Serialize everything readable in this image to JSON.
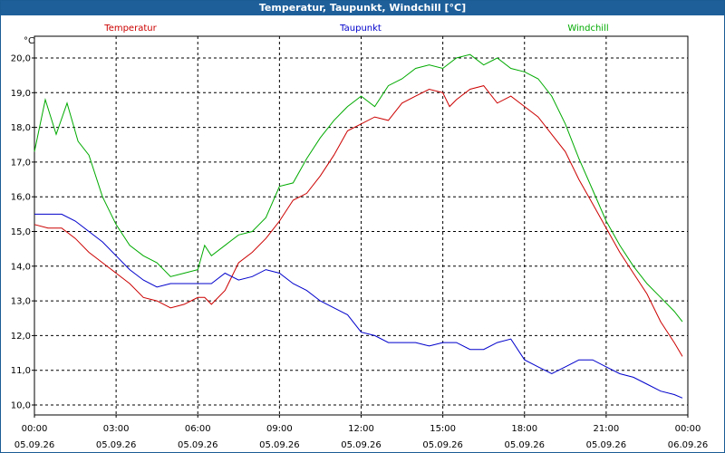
{
  "window": {
    "title": "Temperatur, Taupunkt, Windchill [°C]"
  },
  "chart_data": {
    "type": "line",
    "title": "Temperatur, Taupunkt, Windchill [°C]",
    "ylabel": "°C",
    "xlabel": "",
    "ylim": [
      9.8,
      20.6
    ],
    "xlim": [
      0,
      24
    ],
    "grid": true,
    "legend_placement": "top",
    "y_ticks": [
      "10,0",
      "11,0",
      "12,0",
      "13,0",
      "14,0",
      "15,0",
      "16,0",
      "17,0",
      "18,0",
      "19,0",
      "20,0"
    ],
    "x_ticks": [
      {
        "time": "00:00",
        "date": "05.09.26"
      },
      {
        "time": "03:00",
        "date": "05.09.26"
      },
      {
        "time": "06:00",
        "date": "05.09.26"
      },
      {
        "time": "09:00",
        "date": "05.09.26"
      },
      {
        "time": "12:00",
        "date": "05.09.26"
      },
      {
        "time": "15:00",
        "date": "05.09.26"
      },
      {
        "time": "18:00",
        "date": "05.09.26"
      },
      {
        "time": "21:00",
        "date": "05.09.26"
      },
      {
        "time": "00:00",
        "date": "06.09.26"
      }
    ],
    "series": [
      {
        "name": "Temperatur",
        "color": "#cc0000",
        "x": [
          0,
          0.5,
          1,
          1.5,
          2,
          2.5,
          3,
          3.5,
          4,
          4.5,
          5,
          5.5,
          6,
          6.25,
          6.5,
          7,
          7.5,
          8,
          8.5,
          9,
          9.5,
          10,
          10.5,
          11,
          11.5,
          12,
          12.5,
          13,
          13.5,
          14,
          14.5,
          15,
          15.25,
          15.5,
          16,
          16.5,
          17,
          17.5,
          18,
          18.5,
          19,
          19.5,
          20,
          20.5,
          21,
          21.5,
          22,
          22.5,
          23,
          23.5,
          23.8
        ],
        "y": [
          15.2,
          15.1,
          15.1,
          14.8,
          14.4,
          14.1,
          13.8,
          13.5,
          13.1,
          13.0,
          12.8,
          12.9,
          13.1,
          13.1,
          12.9,
          13.3,
          14.1,
          14.4,
          14.8,
          15.3,
          15.9,
          16.1,
          16.6,
          17.2,
          17.9,
          18.1,
          18.3,
          18.2,
          18.7,
          18.9,
          19.1,
          19.0,
          18.6,
          18.8,
          19.1,
          19.2,
          18.7,
          18.9,
          18.6,
          18.3,
          17.8,
          17.3,
          16.5,
          15.8,
          15.1,
          14.4,
          13.8,
          13.2,
          12.4,
          11.8,
          11.4
        ]
      },
      {
        "name": "Taupunkt",
        "color": "#0000cc",
        "x": [
          0,
          0.5,
          1,
          1.5,
          2,
          2.5,
          3,
          3.5,
          4,
          4.5,
          5,
          5.5,
          6,
          6.5,
          7,
          7.5,
          8,
          8.5,
          9,
          9.5,
          10,
          10.5,
          11,
          11.5,
          12,
          12.5,
          13,
          13.5,
          14,
          14.5,
          15,
          15.5,
          16,
          16.5,
          17,
          17.5,
          18,
          18.5,
          19,
          19.5,
          20,
          20.5,
          21,
          21.5,
          22,
          22.5,
          23,
          23.5,
          23.8
        ],
        "y": [
          15.5,
          15.5,
          15.5,
          15.3,
          15.0,
          14.7,
          14.3,
          13.9,
          13.6,
          13.4,
          13.5,
          13.5,
          13.5,
          13.5,
          13.8,
          13.6,
          13.7,
          13.9,
          13.8,
          13.5,
          13.3,
          13.0,
          12.8,
          12.6,
          12.1,
          12.0,
          11.8,
          11.8,
          11.8,
          11.7,
          11.8,
          11.8,
          11.6,
          11.6,
          11.8,
          11.9,
          11.3,
          11.1,
          10.9,
          11.1,
          11.3,
          11.3,
          11.1,
          10.9,
          10.8,
          10.6,
          10.4,
          10.3,
          10.2
        ]
      },
      {
        "name": "Windchill",
        "color": "#00aa00",
        "x": [
          0,
          0.4,
          0.8,
          1.2,
          1.6,
          2,
          2.5,
          3,
          3.5,
          4,
          4.5,
          5,
          5.5,
          6,
          6.25,
          6.5,
          7,
          7.5,
          8,
          8.5,
          9,
          9.5,
          10,
          10.5,
          11,
          11.5,
          12,
          12.5,
          13,
          13.5,
          14,
          14.5,
          15,
          15.5,
          16,
          16.5,
          17,
          17.5,
          18,
          18.5,
          19,
          19.5,
          20,
          20.5,
          21,
          21.5,
          22,
          22.5,
          23,
          23.5,
          23.8
        ],
        "y": [
          17.3,
          18.8,
          17.8,
          18.7,
          17.6,
          17.2,
          16.0,
          15.2,
          14.6,
          14.3,
          14.1,
          13.7,
          13.8,
          13.9,
          14.6,
          14.3,
          14.6,
          14.9,
          15.0,
          15.4,
          16.3,
          16.4,
          17.1,
          17.7,
          18.2,
          18.6,
          18.9,
          18.6,
          19.2,
          19.4,
          19.7,
          19.8,
          19.7,
          20.0,
          20.1,
          19.8,
          20.0,
          19.7,
          19.6,
          19.4,
          18.9,
          18.1,
          17.1,
          16.2,
          15.3,
          14.6,
          14.0,
          13.5,
          13.1,
          12.7,
          12.4
        ]
      }
    ]
  }
}
